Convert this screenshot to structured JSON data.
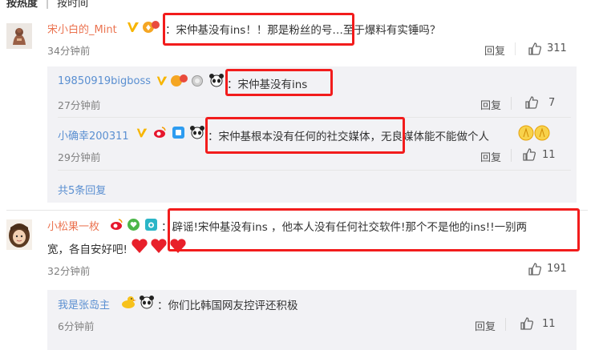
{
  "tabs": {
    "hot": "按热度",
    "time": "按时间"
  },
  "comments": [
    {
      "user": "宋小白的_Mint",
      "text": "：宋仲基没有ins！！那是粉丝的号…至于爆料有实锤吗？",
      "time": "34分钟前",
      "reply_label": "回复",
      "likes": "311"
    },
    {
      "user": "小松果一枚",
      "text_line1": "：辟谣!宋仲基没有ins ，他本人没有任何社交软件!那个不是他的ins!!一别两",
      "text_line2": "宽，各自安好吧!",
      "time": "32分钟前",
      "reply_label": "回复",
      "likes": "191"
    }
  ],
  "replies": [
    {
      "user": "19850919bigboss",
      "text": "：宋仲基没有ins",
      "time": "27分钟前",
      "reply_label": "回复",
      "likes": "7"
    },
    {
      "user": "小确幸200311",
      "text": "：宋仲基根本没有任何的社交媒体，无良媒体能不能做个人",
      "time": "29分钟前",
      "reply_label": "回复",
      "likes": "11"
    },
    {
      "user": "我是张岛主",
      "text": "：你们比韩国网友控评还积极",
      "time": "6分钟前",
      "reply_label": "回复",
      "likes": "11"
    }
  ],
  "more_replies": "共5条回复",
  "colors": {
    "highlight_box": "#f21c1c",
    "link_blue": "#5a8fd1",
    "name_orange": "#eb7350"
  }
}
